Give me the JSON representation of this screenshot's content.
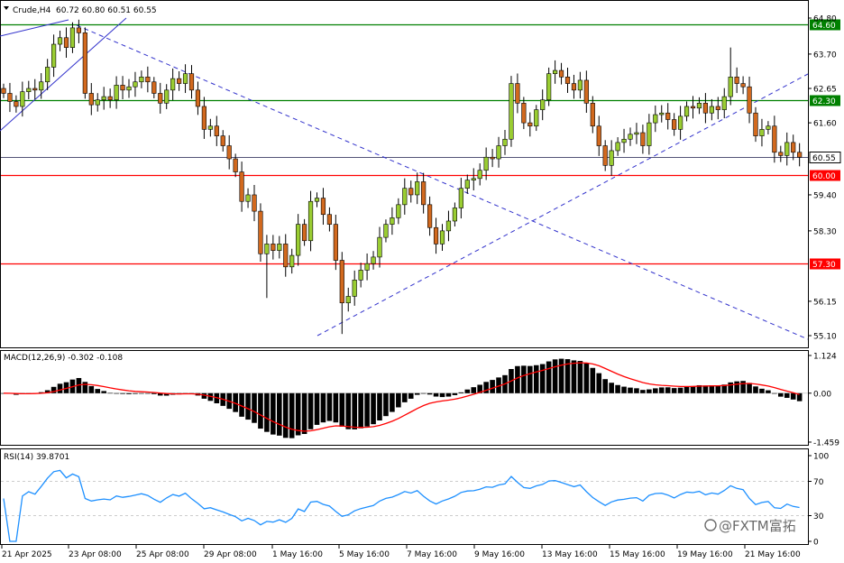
{
  "header": {
    "symbol": "Crude,H4",
    "ohlc": "60.72 60.80 60.51 60.55",
    "macd_label": "MACD(12,26,9) -0.302 -0.108",
    "rsi_label": "RSI(14) 39.8701"
  },
  "colors": {
    "bull": "#9acd32",
    "bear": "#d2691e",
    "support": "#ff0000",
    "resistance": "#008000",
    "trend": "#3333cc",
    "signal": "#ff0000",
    "rsi": "#1e90ff"
  },
  "watermark": "@FXTM富拓",
  "chart_data": [
    {
      "type": "candlestick",
      "title": "Crude,H4",
      "ylim": [
        55.1,
        64.8
      ],
      "y_ticks": [
        "64.80",
        "63.70",
        "62.65",
        "61.60",
        "59.40",
        "58.30",
        "56.15",
        "55.10"
      ],
      "x_ticks": [
        "21 Apr 2025",
        "23 Apr 08:00",
        "25 Apr 08:00",
        "29 Apr 08:00",
        "1 May 16:00",
        "5 May 16:00",
        "7 May 16:00",
        "9 May 16:00",
        "13 May 16:00",
        "15 May 16:00",
        "19 May 16:00",
        "21 May 16:00"
      ],
      "levels": [
        {
          "value": 64.6,
          "label": "64.60",
          "kind": "resistance"
        },
        {
          "value": 62.3,
          "label": "62.30",
          "kind": "resistance"
        },
        {
          "value": 60.0,
          "label": "60.00",
          "kind": "support"
        },
        {
          "value": 57.3,
          "label": "57.30",
          "kind": "support"
        }
      ],
      "current": {
        "value": 60.55,
        "label": "60.55"
      },
      "closes": [
        62.5,
        62.25,
        62.1,
        62.55,
        62.65,
        62.6,
        62.85,
        63.3,
        64.0,
        64.2,
        63.9,
        64.5,
        64.35,
        62.5,
        62.15,
        62.3,
        62.4,
        62.3,
        62.75,
        62.6,
        62.7,
        62.85,
        63.0,
        62.85,
        62.5,
        62.2,
        62.6,
        62.95,
        62.8,
        63.1,
        62.6,
        62.1,
        61.4,
        61.5,
        61.2,
        60.9,
        60.5,
        60.1,
        59.2,
        59.4,
        58.9,
        57.6,
        57.9,
        57.7,
        57.9,
        57.2,
        57.55,
        58.5,
        58.0,
        59.2,
        59.3,
        58.8,
        58.5,
        57.4,
        56.1,
        56.3,
        56.8,
        57.1,
        57.3,
        57.5,
        58.1,
        58.5,
        58.7,
        59.1,
        59.6,
        59.4,
        59.8,
        59.1,
        58.4,
        57.9,
        58.3,
        58.6,
        59.0,
        59.6,
        59.85,
        59.9,
        60.15,
        60.55,
        60.5,
        60.9,
        61.1,
        62.8,
        62.2,
        61.6,
        61.5,
        62.0,
        62.3,
        63.1,
        63.2,
        63.0,
        62.8,
        62.6,
        62.9,
        62.2,
        61.5,
        60.9,
        60.3,
        60.75,
        61.0,
        61.1,
        61.25,
        61.3,
        60.9,
        61.6,
        61.85,
        61.9,
        61.7,
        61.4,
        61.8,
        62.1,
        62.05,
        62.2,
        61.9,
        62.1,
        62.0,
        62.4,
        63.0,
        62.8,
        62.7,
        61.9,
        61.2,
        61.4,
        61.5,
        60.7,
        60.6,
        61.0,
        60.7,
        60.55
      ],
      "macd": {
        "ylim": [
          -1.459,
          1.124
        ],
        "y_ticks": [
          "1.124",
          "0.00",
          "-1.459"
        ],
        "label": "MACD(12,26,9) -0.302 -0.108"
      },
      "rsi": {
        "ylim": [
          0,
          100
        ],
        "y_ticks": [
          "100",
          "70",
          "30",
          "0"
        ],
        "label": "RSI(14) 39.8701"
      }
    }
  ]
}
